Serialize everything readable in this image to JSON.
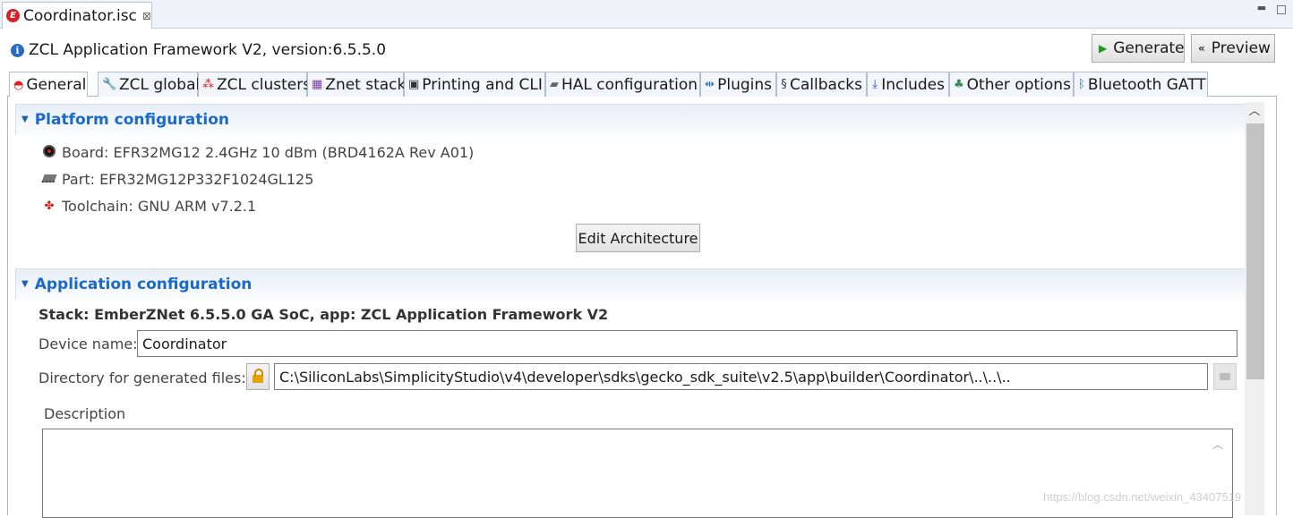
{
  "editor_tab": {
    "title": "Coordinator.isc",
    "icon": "ember-e-icon",
    "close": "⊠"
  },
  "window_controls": {
    "minimize": "▬",
    "maximize": ""
  },
  "header": {
    "title": "ZCL Application Framework V2, version:6.5.5.0",
    "generate_label": "Generate",
    "preview_label": "Preview"
  },
  "tabs": [
    {
      "label": "General",
      "icon": "half-circle-red-icon"
    },
    {
      "label": "ZCL global",
      "icon": "wrench-icon"
    },
    {
      "label": "ZCL clusters",
      "icon": "cluster-nodes-icon"
    },
    {
      "label": "Znet stack",
      "icon": "stack-bars-icon"
    },
    {
      "label": "Printing and CLI",
      "icon": "terminal-icon"
    },
    {
      "label": "HAL configuration",
      "icon": "chip-icon"
    },
    {
      "label": "Plugins",
      "icon": "plugin-icon"
    },
    {
      "label": "Callbacks",
      "icon": "callback-icon"
    },
    {
      "label": "Includes",
      "icon": "include-icon"
    },
    {
      "label": "Other options",
      "icon": "options-icon"
    },
    {
      "label": "Bluetooth GATT",
      "icon": "bluetooth-icon"
    }
  ],
  "platform": {
    "section_title": "Platform configuration",
    "board": "Board: EFR32MG12 2.4GHz 10 dBm (BRD4162A Rev A01)",
    "part": "Part: EFR32MG12P332F1024GL125",
    "toolchain": "Toolchain: GNU ARM v7.2.1",
    "edit_button": "Edit Architecture"
  },
  "application": {
    "section_title": "Application configuration",
    "stack_line": "Stack: EmberZNet 6.5.5.0 GA SoC, app: ZCL Application Framework V2",
    "device_name_label": "Device name:",
    "device_name_value": "Coordinator",
    "dir_label": "Directory for generated files:",
    "dir_value": "C:\\SiliconLabs\\SimplicityStudio\\v4\\developer\\sdks\\gecko_sdk_suite\\v2.5\\app\\builder\\Coordinator\\..\\..\\..",
    "description_label": "Description",
    "description_value": ""
  },
  "watermark": "https://blog.csdn.net/weixin_43407519"
}
